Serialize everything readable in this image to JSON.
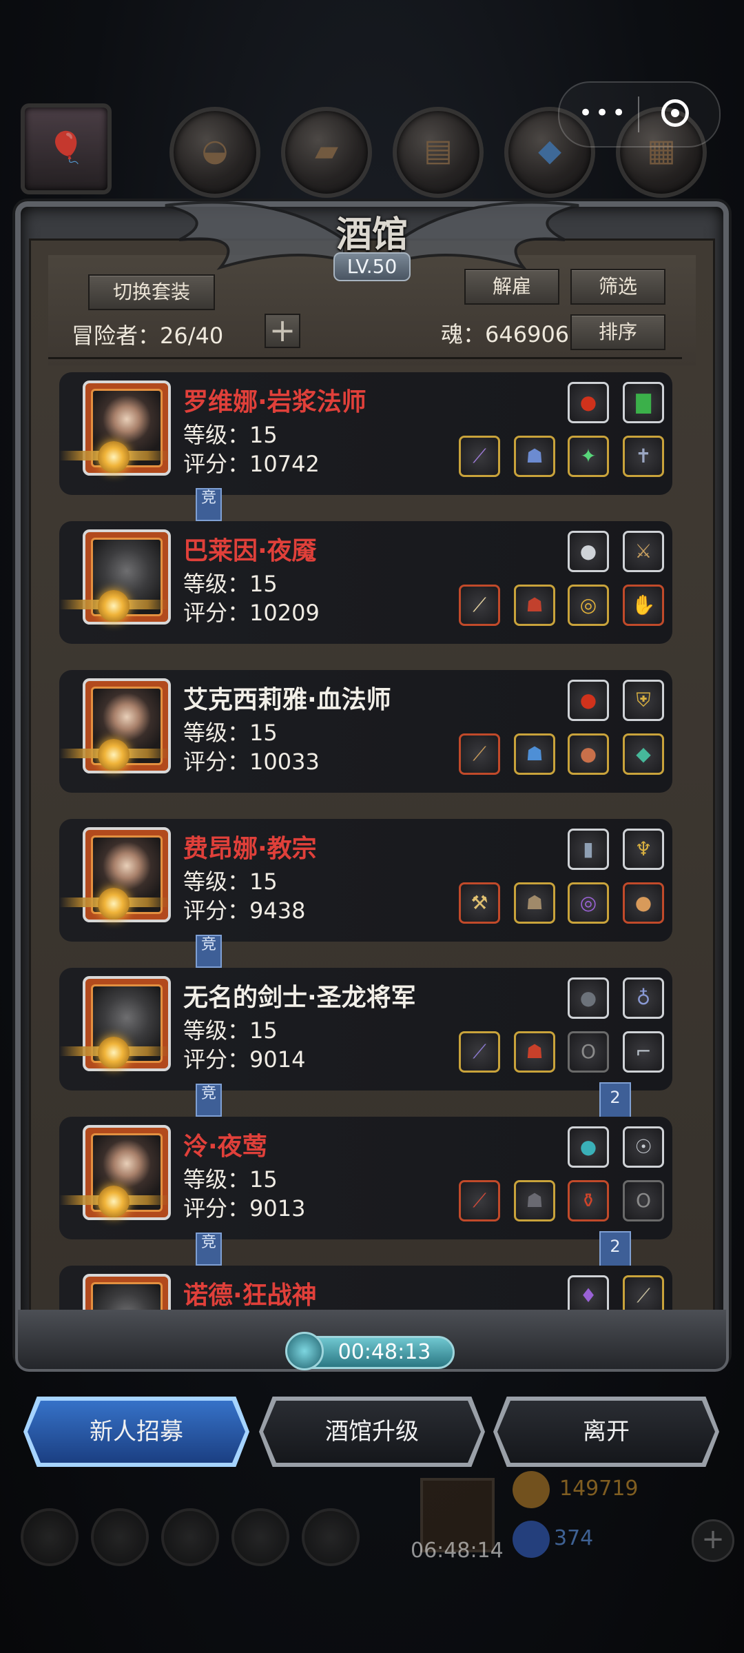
{
  "menu": {
    "more_label": "•••"
  },
  "header": {
    "title": "酒馆",
    "level": "LV.50"
  },
  "toolbar": {
    "switch_outfit": "切换套装",
    "dismiss": "解雇",
    "filter": "筛选",
    "sort": "排序",
    "adventurers_label": "冒险者：26/40",
    "add_label": "+",
    "soul_label": "魂：646906"
  },
  "heroes": [
    {
      "name": "罗维娜·岩浆法师",
      "level": "等级：15",
      "score": "评分：10742",
      "name_color": "red",
      "tag": "竞"
    },
    {
      "name": "巴莱因·夜魇",
      "level": "等级：15",
      "score": "评分：10209",
      "name_color": "red"
    },
    {
      "name": "艾克西莉雅·血法师",
      "level": "等级：15",
      "score": "评分：10033",
      "name_color": "white"
    },
    {
      "name": "费昂娜·教宗",
      "level": "等级：15",
      "score": "评分：9438",
      "name_color": "red",
      "tag": "竞"
    },
    {
      "name": "无名的剑士·圣龙将军",
      "level": "等级：15",
      "score": "评分：9014",
      "name_color": "white",
      "tag": "竞",
      "badge": "2"
    },
    {
      "name": "泠·夜莺",
      "level": "等级：15",
      "score": "评分：9013",
      "name_color": "red",
      "tag": "竞",
      "badge": "2"
    },
    {
      "name": "诺德·狂战神",
      "name_color": "red"
    }
  ],
  "timer": "00:48:13",
  "actions": {
    "recruit": "新人招募",
    "upgrade": "酒馆升级",
    "leave": "离开"
  },
  "background": {
    "gold": "149719",
    "gems": "374",
    "gift_timer": "06:48:14"
  },
  "colors": {
    "name_red": "#e0403a",
    "accent_blue": "#3672c8",
    "gold_border": "#c9a33b"
  }
}
